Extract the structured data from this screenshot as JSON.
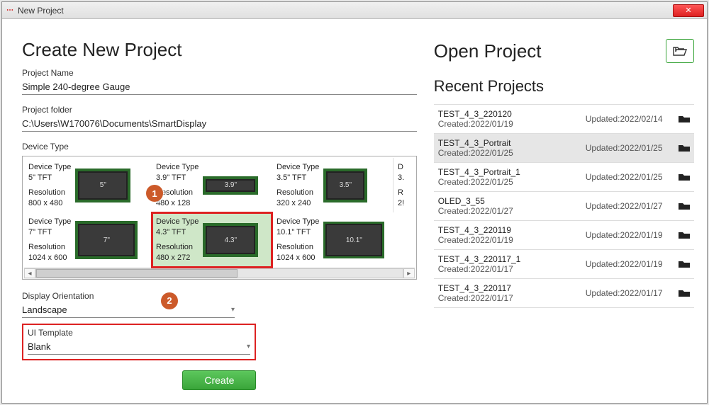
{
  "window": {
    "title": "New Project"
  },
  "left": {
    "heading": "Create New Project",
    "project_name_label": "Project Name",
    "project_name_value": "Simple 240-degree Gauge",
    "project_folder_label": "Project folder",
    "project_folder_value": "C:\\Users\\W170076\\Documents\\SmartDisplay",
    "device_type_label": "Device Type",
    "orientation_label": "Display Orientation",
    "orientation_value": "Landscape",
    "ui_template_label": "UI Template",
    "ui_template_value": "Blank",
    "create_label": "Create",
    "badges": {
      "b1": "1",
      "b2": "2"
    },
    "devices": {
      "info_type_label": "Device Type",
      "info_res_label": "Resolution",
      "row1": [
        {
          "type": "5\" TFT",
          "res": "800 x 480",
          "thumb": "5\""
        },
        {
          "type": "3.9\" TFT",
          "res": "480 x 128",
          "thumb": "3.9\""
        },
        {
          "type": "3.5\" TFT",
          "res": "320 x 240",
          "thumb": "3.5\""
        },
        {
          "type_partial": "D",
          "size_partial": "3.",
          "res_partial": "R",
          "res2_partial": "2!"
        }
      ],
      "row2": [
        {
          "type": "7\" TFT",
          "res": "1024 x 600",
          "thumb": "7\""
        },
        {
          "type": "4.3\" TFT",
          "res": "480 x 272",
          "thumb": "4.3\"",
          "selected": true
        },
        {
          "type": "10.1\" TFT",
          "res": "1024 x 600",
          "thumb": "10.1\""
        }
      ]
    }
  },
  "right": {
    "open_heading": "Open Project",
    "recent_heading": "Recent Projects",
    "created_prefix": "Created:",
    "updated_prefix": "Updated:",
    "items": [
      {
        "name": "TEST_4_3_220120",
        "created": "2022/01/19",
        "updated": "2022/02/14"
      },
      {
        "name": "TEST_4_3_Portrait",
        "created": "2022/01/25",
        "updated": "2022/01/25",
        "selected": true
      },
      {
        "name": "TEST_4_3_Portrait_1",
        "created": "2022/01/25",
        "updated": "2022/01/25"
      },
      {
        "name": "OLED_3_55",
        "created": "2022/01/27",
        "updated": "2022/01/27"
      },
      {
        "name": "TEST_4_3_220119",
        "created": "2022/01/19",
        "updated": "2022/01/19"
      },
      {
        "name": "TEST_4_3_220117_1",
        "created": "2022/01/17",
        "updated": "2022/01/19"
      },
      {
        "name": "TEST_4_3_220117",
        "created": "2022/01/17",
        "updated": "2022/01/17"
      }
    ]
  }
}
